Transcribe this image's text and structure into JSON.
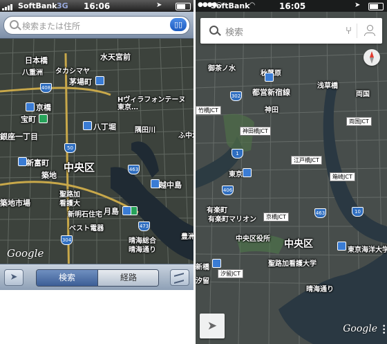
{
  "left": {
    "status": {
      "carrier": "SoftBank",
      "network": "3G",
      "time": "16:06"
    },
    "search": {
      "placeholder": "検索または住所",
      "bookmarks_icon": "book-icon"
    },
    "map_labels": [
      {
        "text": "日本橋",
        "cls": "md"
      },
      {
        "text": "八重洲",
        "cls": "sm"
      },
      {
        "text": "タカシマヤ",
        "cls": "sm"
      },
      {
        "text": "水天宮前",
        "cls": "md"
      },
      {
        "text": "茅場町",
        "cls": "md"
      },
      {
        "text": "京橋",
        "cls": "md"
      },
      {
        "text": "Hヴィラフォンテーヌ東京…",
        "cls": "sm"
      },
      {
        "text": "宝町",
        "cls": "md"
      },
      {
        "text": "八丁堀",
        "cls": "md"
      },
      {
        "text": "隅田川",
        "cls": "sm"
      },
      {
        "text": "銀座一丁目",
        "cls": "md"
      },
      {
        "text": "新富町",
        "cls": "md"
      },
      {
        "text": "中央区",
        "cls": "lg"
      },
      {
        "text": "築地",
        "cls": "md"
      },
      {
        "text": "聖路加",
        "cls": "sm"
      },
      {
        "text": "看護大",
        "cls": "sm"
      },
      {
        "text": "築地市場",
        "cls": "md"
      },
      {
        "text": "月島",
        "cls": "md"
      },
      {
        "text": "新明石住宅",
        "cls": "sm"
      },
      {
        "text": "ベスト電器",
        "cls": "sm"
      },
      {
        "text": "越中島",
        "cls": "md"
      },
      {
        "text": "晴海総合",
        "cls": "sm"
      },
      {
        "text": "晴海通り",
        "cls": "sm"
      },
      {
        "text": "豊洲",
        "cls": "sm"
      },
      {
        "text": "ふ中水",
        "cls": "sm"
      }
    ],
    "route_shields": [
      "408",
      "50",
      "463",
      "473",
      "304"
    ],
    "attribution": "Google",
    "toolbar": {
      "location_icon": "location-arrow-icon",
      "search_tab": "検索",
      "route_tab": "経路",
      "page_curl_icon": "page-curl-icon"
    }
  },
  "right": {
    "status": {
      "carrier": "SoftBank",
      "time": "16:05"
    },
    "search": {
      "placeholder": "検索",
      "directions_icon": "directions-icon",
      "account_icon": "account-icon"
    },
    "map_labels": [
      {
        "text": "御茶ノ水",
        "cls": "sm"
      },
      {
        "text": "秋葉原",
        "cls": "sm"
      },
      {
        "text": "両国",
        "cls": "sm"
      },
      {
        "text": "浅草橋",
        "cls": "sm"
      },
      {
        "text": "都営新宿線",
        "cls": "md"
      },
      {
        "text": "神田",
        "cls": "sm"
      },
      {
        "text": "東京",
        "cls": "sm"
      },
      {
        "text": "有楽町",
        "cls": "sm"
      },
      {
        "text": "有楽町マリオン",
        "cls": "sm"
      },
      {
        "text": "中央区役所",
        "cls": "sm"
      },
      {
        "text": "中央区",
        "cls": "xl"
      },
      {
        "text": "聖路加看護大学",
        "cls": "sm"
      },
      {
        "text": "新橋",
        "cls": "sm"
      },
      {
        "text": "汐留",
        "cls": "sm"
      },
      {
        "text": "東京海洋大学",
        "cls": "sm"
      },
      {
        "text": "晴海通り",
        "cls": "sm"
      }
    ],
    "jct_labels": [
      "竹橋JCT",
      "両国JCT",
      "神田橋JCT",
      "江戸橋JCT",
      "箱崎JCT",
      "京橋JCT",
      "汐留JCT"
    ],
    "route_shields": [
      "302",
      "1",
      "406",
      "463",
      "10"
    ],
    "attribution": "Google",
    "controls": {
      "location_icon": "location-arrow-icon",
      "compass_icon": "compass-icon"
    }
  }
}
